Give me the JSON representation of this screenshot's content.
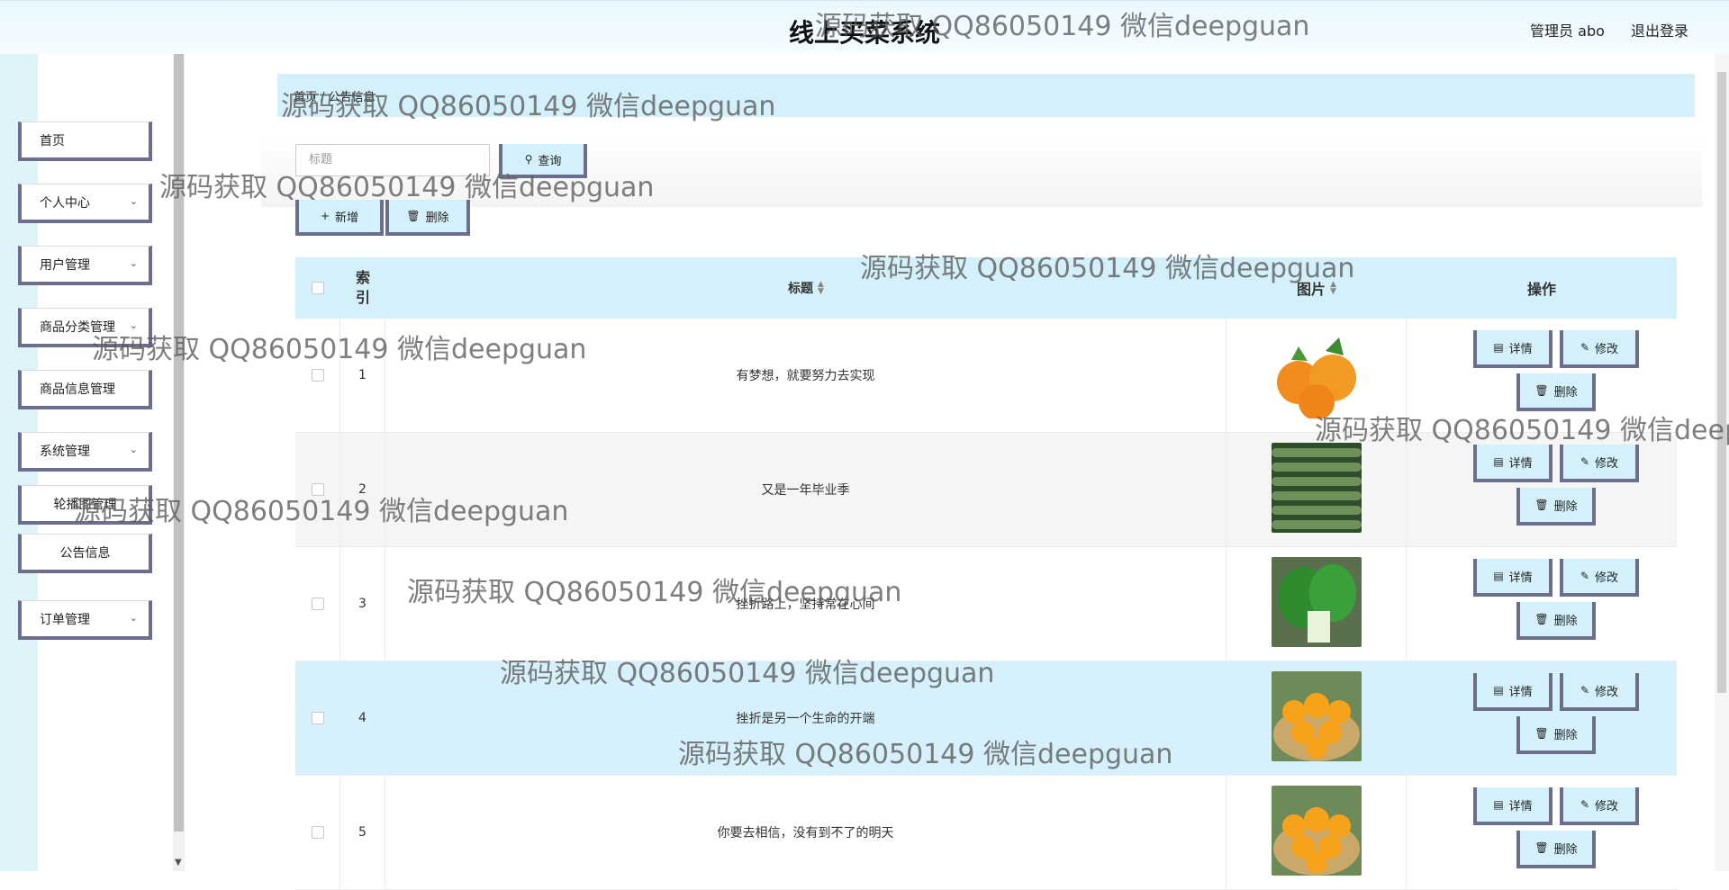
{
  "header": {
    "app_title": "线上买菜系统",
    "user_label": "管理员 abo",
    "logout_label": "退出登录"
  },
  "sidebar": {
    "items": [
      {
        "label": "首页",
        "expandable": false
      },
      {
        "label": "个人中心",
        "expandable": true
      },
      {
        "label": "用户管理",
        "expandable": true
      },
      {
        "label": "商品分类管理",
        "expandable": true
      },
      {
        "label": "商品信息管理",
        "expandable": true
      },
      {
        "label": "系统管理",
        "expandable": true
      },
      {
        "label": "轮播图管理",
        "expandable": false
      },
      {
        "label": "公告信息",
        "expandable": false
      },
      {
        "label": "订单管理",
        "expandable": true
      }
    ]
  },
  "breadcrumb": {
    "text": "首页 / 公告信息"
  },
  "search": {
    "placeholder": "标题",
    "button_label": "查询"
  },
  "toolbar": {
    "add_label": "新增",
    "delete_label": "删除"
  },
  "table": {
    "headers": {
      "index": "索\n引",
      "title": "标题",
      "image": "图片",
      "actions": "操作"
    },
    "rows": [
      {
        "index": "1",
        "title": "有梦想，就要努力去实现",
        "image": "oranges"
      },
      {
        "index": "2",
        "title": "又是一年毕业季",
        "image": "cucumbers"
      },
      {
        "index": "3",
        "title": "挫折路上，坚持常在心间",
        "image": "greens"
      },
      {
        "index": "4",
        "title": "挫折是另一个生命的开端",
        "image": "orange-basket"
      },
      {
        "index": "5",
        "title": "你要去相信，没有到不了的明天",
        "image": "orange-basket"
      }
    ],
    "actions": {
      "detail": "详情",
      "edit": "修改",
      "delete": "删除"
    }
  },
  "watermark": "源码获取 QQ86050149 微信deepguan",
  "colors": {
    "accent": "#d4f1fb",
    "button_border": "#6b6f8c",
    "sidebar_bg": "#dff3fb"
  }
}
